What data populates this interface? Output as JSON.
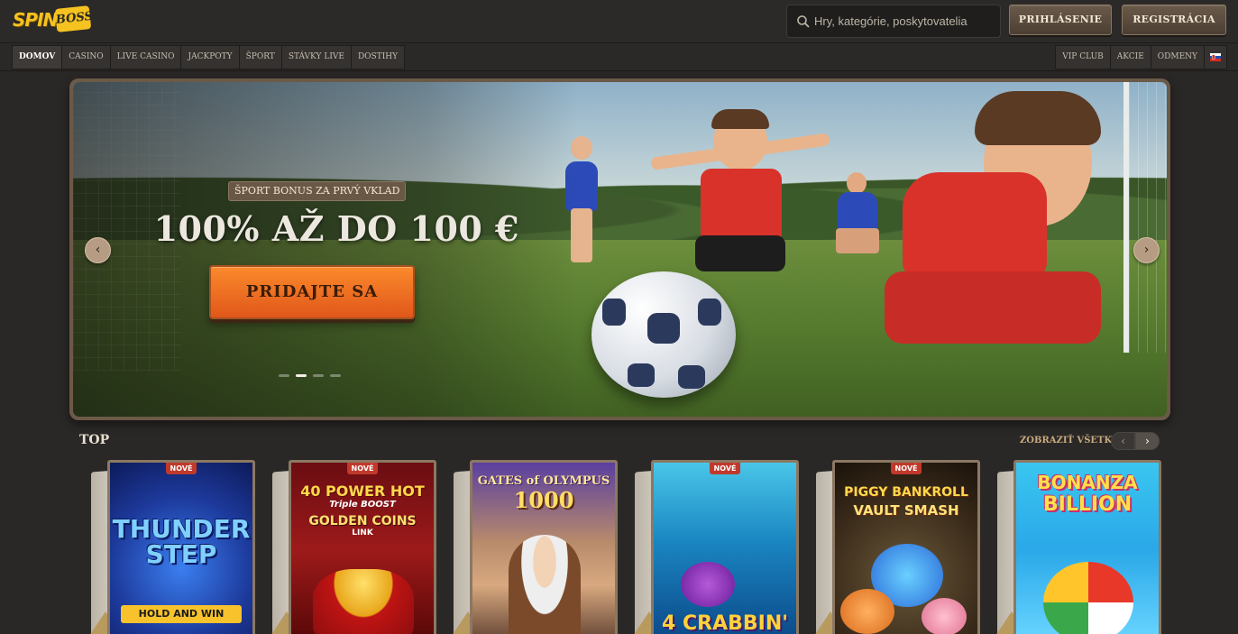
{
  "header": {
    "logo_text": "SPIN",
    "logo_badge": "BOSS",
    "search_placeholder": "Hry, kategórie, poskytovatelia",
    "login_label": "PRIHLÁSENIE",
    "register_label": "REGISTRÁCIA"
  },
  "nav": {
    "left": [
      "DOMOV",
      "CASINO",
      "LIVE CASINO",
      "JACKPOTY",
      "ŠPORT",
      "STÁVKY LIVE",
      "DOSTIHY"
    ],
    "active": "DOMOV",
    "right": [
      "VIP CLUB",
      "AKCIE",
      "ODMENY"
    ],
    "language_icon": "slovak-flag-icon"
  },
  "hero": {
    "badge": "ŠPORT BONUS ZA PRVÝ VKLAD",
    "title": "100% AŽ DO 100 €",
    "cta": "PRIDAJTE SA",
    "prev_icon": "‹",
    "next_icon": "›",
    "slides_count": 4,
    "active_slide": 2
  },
  "top": {
    "title": "TOP",
    "show_all": "ZOBRAZIŤ VŠETKO",
    "prev": "‹",
    "next": "›",
    "games": [
      {
        "name": "THUNDER STEP",
        "subtitle": "HOLD AND WIN",
        "badge": "NOVÉ"
      },
      {
        "name": "40 POWER HOT",
        "subtitle": "Triple BOOST",
        "subtitle2": "GOLDEN COINS",
        "subtitle3": "LINK",
        "badge": "NOVÉ"
      },
      {
        "name": "GATES of OLYMPUS",
        "subtitle": "1000",
        "badge": ""
      },
      {
        "name": "4 CRABBIN'",
        "badge": "NOVÉ"
      },
      {
        "name": "PIGGY BANKROLL",
        "subtitle": "VAULT SMASH",
        "badge": "NOVÉ"
      },
      {
        "name": "BONANZA",
        "subtitle": "BILLION",
        "badge": ""
      }
    ]
  },
  "colors": {
    "accent": "#fb8a2c",
    "gold": "#f6c21f",
    "new_badge": "#c0392b"
  }
}
